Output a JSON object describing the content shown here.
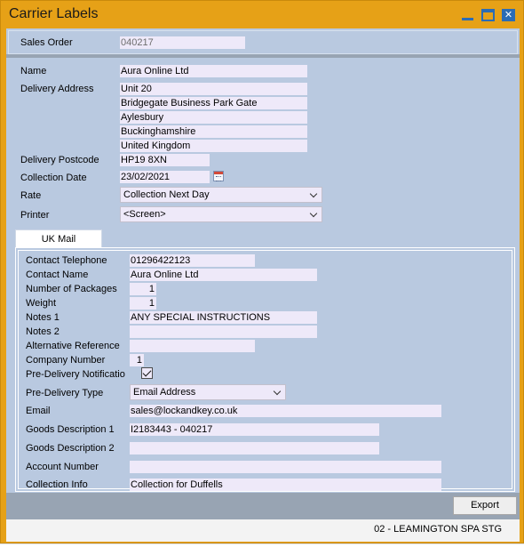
{
  "window": {
    "title": "Carrier Labels"
  },
  "sales_order": {
    "label": "Sales Order",
    "value": "040217"
  },
  "form": {
    "name_label": "Name",
    "name": "Aura Online Ltd",
    "address_label": "Delivery Address",
    "address": [
      "Unit 20",
      "Bridgegate Business Park Gate",
      "Aylesbury",
      "Buckinghamshire",
      "United Kingdom"
    ],
    "postcode_label": "Delivery Postcode",
    "postcode": "HP19 8XN",
    "collection_date_label": "Collection Date",
    "collection_date": "23/02/2021",
    "rate_label": "Rate",
    "rate": "Collection Next Day",
    "printer_label": "Printer",
    "printer": "<Screen>"
  },
  "tab": {
    "label": "UK Mail",
    "fields": {
      "contact_telephone_label": "Contact Telephone",
      "contact_telephone": "01296422123",
      "contact_name_label": "Contact Name",
      "contact_name": "Aura Online Ltd",
      "num_packages_label": "Number of Packages",
      "num_packages": "1",
      "weight_label": "Weight",
      "weight": "1",
      "notes1_label": "Notes 1",
      "notes1": "ANY SPECIAL INSTRUCTIONS",
      "notes2_label": "Notes 2",
      "notes2": "",
      "alt_ref_label": "Alternative Reference",
      "alt_ref": "",
      "company_number_label": "Company Number",
      "company_number": "1",
      "pre_delivery_notification_label": "Pre-Delivery Notificatio",
      "pre_delivery_notification_checked": true,
      "pre_delivery_type_label": "Pre-Delivery Type",
      "pre_delivery_type": "Email Address",
      "email_label": "Email",
      "email": "sales@lockandkey.co.uk",
      "goods_desc1_label": "Goods Description 1",
      "goods_desc1": "I2183443 - 040217",
      "goods_desc2_label": "Goods Description 2",
      "goods_desc2": "",
      "account_number_label": "Account Number",
      "account_number": "",
      "collection_info_label": "Collection Info",
      "collection_info": "Collection for Duffells"
    }
  },
  "footer": {
    "export_label": "Export"
  },
  "status": {
    "text": "02 - LEAMINGTON SPA   STG"
  }
}
